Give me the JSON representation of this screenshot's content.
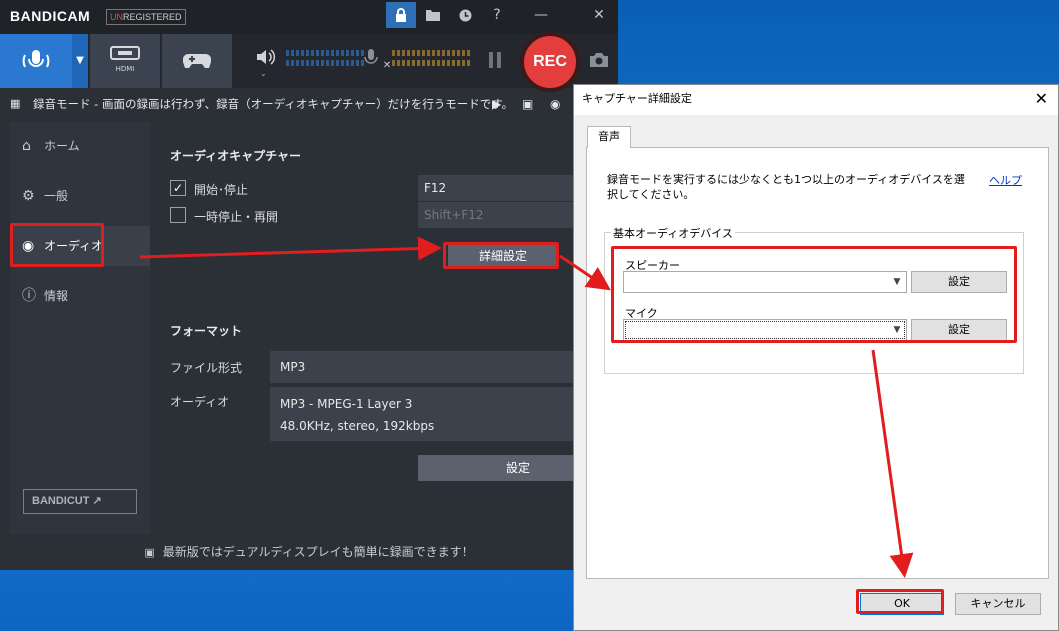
{
  "app": {
    "logo": "BANDICAM",
    "badge_prefix": "UN",
    "badge_rest": "REGISTERED"
  },
  "titlebar_icons": [
    "lock-icon",
    "folder-icon",
    "clock-icon",
    "help-icon",
    "minimize-icon",
    "close-icon"
  ],
  "titlebar_glyphs": {
    "help": "?",
    "minimize": "—",
    "close": "✕"
  },
  "toolbar": {
    "hdmi_label": "HDMI",
    "rec_label": "REC"
  },
  "infobar": {
    "text": "録音モード - 画面の録画は行わず、録音（オーディオキャプチャー）だけを行うモードです。"
  },
  "sidebar": {
    "items": [
      {
        "label": "ホーム"
      },
      {
        "label": "一般"
      },
      {
        "label": "オーディオ"
      },
      {
        "label": "情報"
      }
    ],
    "bandicut": "BANDICUT ↗"
  },
  "audio_capture": {
    "title": "オーディオキャプチャー",
    "start_stop": {
      "label": "開始･停止",
      "checked": true,
      "hotkey": "F12"
    },
    "pause_resume": {
      "label": "一時停止・再開",
      "checked": false,
      "hotkey": "Shift+F12"
    },
    "advanced_button": "詳細設定"
  },
  "format": {
    "title": "フォーマット",
    "file_type_label": "ファイル形式",
    "file_type": "MP3",
    "audio_label": "オーディオ",
    "audio_codec": "MP3 - MPEG-1 Layer 3",
    "audio_params": "48.0KHz, stereo, 192kbps",
    "settings_button": "設定"
  },
  "footer": {
    "text": "最新版ではデュアルディスプレイも簡単に録画できます！"
  },
  "dialog": {
    "title": "キャプチャー詳細設定",
    "tab": "音声",
    "description": "録音モードを実行するには少なくとも1つ以上のオーディオデバイスを選択してください。",
    "help_link": "ヘルプ",
    "group_title": "基本オーディオデバイス",
    "speaker_label": "スピーカー",
    "speaker_value": "",
    "speaker_button": "設定",
    "mic_label": "マイク",
    "mic_value": "",
    "mic_button": "設定",
    "ok_button": "OK",
    "cancel_button": "キャンセル"
  },
  "colors": {
    "accent": "#2b78d0",
    "rec": "#e43d3d",
    "highlight": "#e11d1d"
  }
}
